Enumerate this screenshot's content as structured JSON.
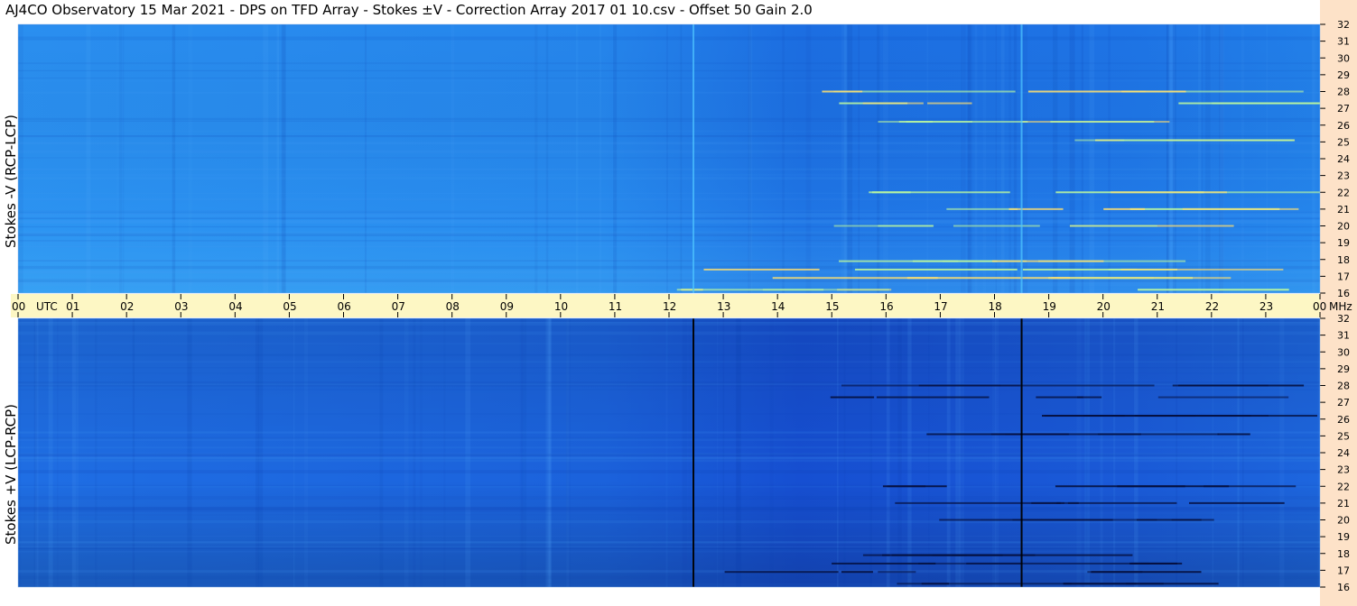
{
  "title": "AJ4CO Observatory  15 Mar 2021  -  DPS on TFD Array  -  Stokes ±V  -  Correction Array 2017 01 10.csv  -  Offset 50  Gain 2.0",
  "colors": {
    "time_axis_band": "#fdf7c4",
    "freq_axis_band": "#fde2c8",
    "spectro_base_top": "#1f7fe8",
    "spectro_base_bottom": "#1c63de",
    "burst_bright": "#b8f5a0",
    "burst_dark": "#051040"
  },
  "chart_data": [
    {
      "type": "heatmap",
      "panel": "top",
      "ylabel": "Stokes -V (RCP-LCP)",
      "x_unit": "UTC",
      "x_ticks": [
        "00",
        "01",
        "02",
        "03",
        "04",
        "05",
        "06",
        "07",
        "08",
        "09",
        "10",
        "11",
        "12",
        "13",
        "14",
        "15",
        "16",
        "17",
        "18",
        "19",
        "20",
        "21",
        "22",
        "23",
        "00"
      ],
      "xlim": [
        0,
        24
      ],
      "y_unit": "MHz",
      "y_ticks": [
        "32",
        "31",
        "30",
        "29",
        "28",
        "27",
        "26",
        "25",
        "24",
        "23",
        "22",
        "21",
        "20",
        "19",
        "18",
        "17",
        "16"
      ],
      "ylim": [
        16,
        32
      ],
      "vertical_lines_utc": [
        12.45,
        18.5
      ],
      "interference_bands_mhz": [
        16.2,
        16.9,
        17.4,
        17.9,
        20.0,
        21.0,
        22.0,
        25.1,
        26.2,
        27.3,
        28.0
      ]
    },
    {
      "type": "heatmap",
      "panel": "bottom",
      "ylabel": "Stokes +V (LCP-RCP)",
      "x_unit": "UTC",
      "x_ticks": [
        "00",
        "01",
        "02",
        "03",
        "04",
        "05",
        "06",
        "07",
        "08",
        "09",
        "10",
        "11",
        "12",
        "13",
        "14",
        "15",
        "16",
        "17",
        "18",
        "19",
        "20",
        "21",
        "22",
        "23",
        "00"
      ],
      "xlim": [
        0,
        24
      ],
      "y_unit": "MHz",
      "y_ticks": [
        "32",
        "31",
        "30",
        "29",
        "28",
        "27",
        "26",
        "25",
        "24",
        "23",
        "22",
        "21",
        "20",
        "19",
        "18",
        "17",
        "16"
      ],
      "ylim": [
        16,
        32
      ],
      "vertical_lines_utc": [
        12.45,
        18.5
      ],
      "interference_bands_mhz": [
        16.2,
        16.9,
        17.4,
        17.9,
        20.0,
        21.0,
        22.0,
        25.1,
        26.2,
        27.3,
        28.0
      ]
    }
  ]
}
